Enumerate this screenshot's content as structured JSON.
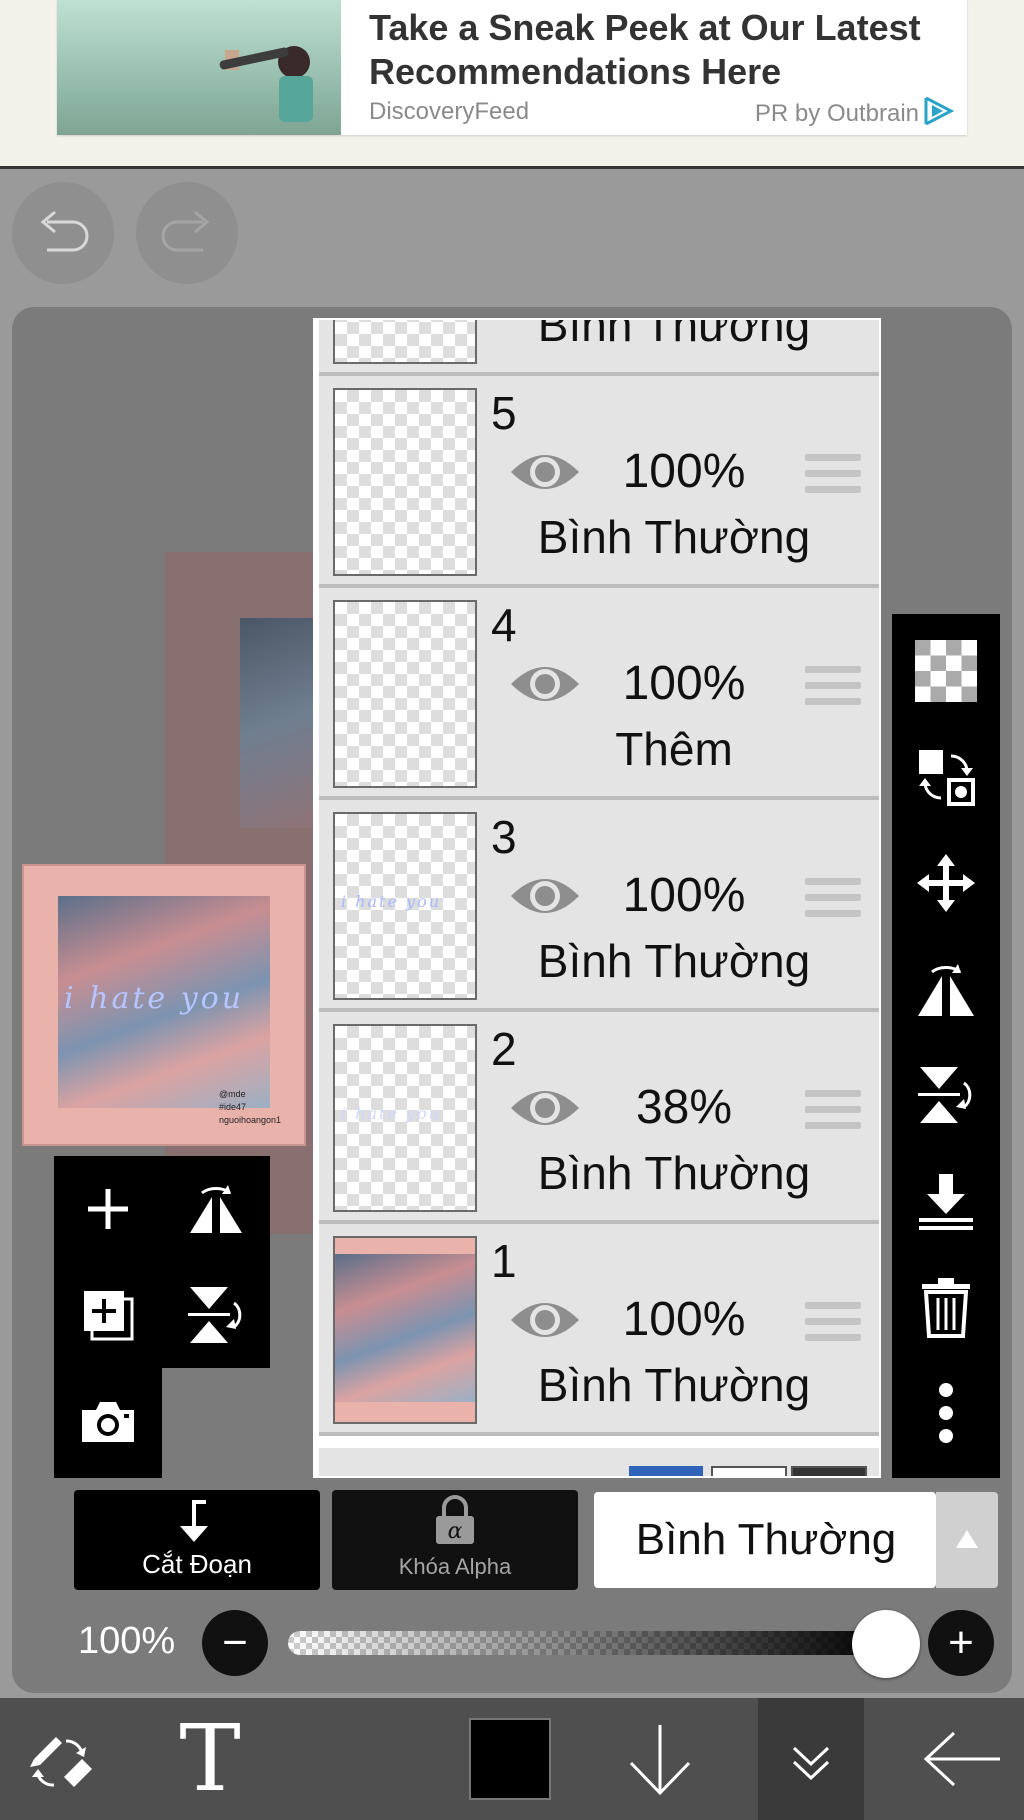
{
  "ad": {
    "title": "Take a Sneak Peek at Our Latest Recommendations Here",
    "source": "DiscoveryFeed",
    "pr_label": "PR by Outbrain"
  },
  "toolbar_top": {
    "undo_icon": "undo-icon",
    "redo_icon": "redo-icon"
  },
  "preview": {
    "overlay_text": "i  hate  you",
    "caption_lines": [
      "@mde",
      "#ide47",
      "nguoihoangon1"
    ]
  },
  "layers": {
    "top_partial_blend": "Bình Thường",
    "items": [
      {
        "number": "5",
        "opacity": "100%",
        "blend": "Bình Thường",
        "visible": true
      },
      {
        "number": "4",
        "opacity": "100%",
        "blend": "Thêm",
        "visible": true
      },
      {
        "number": "3",
        "opacity": "100%",
        "blend": "Bình Thường",
        "visible": true
      },
      {
        "number": "2",
        "opacity": "38%",
        "blend": "Bình Thường",
        "visible": true
      },
      {
        "number": "1",
        "opacity": "100%",
        "blend": "Bình Thường",
        "visible": true
      }
    ]
  },
  "left_tools": [
    "add-layer-icon",
    "flip-horizontal-icon",
    "duplicate-layer-icon",
    "flip-vertical-icon",
    "camera-icon"
  ],
  "right_tools": [
    "transparency-icon",
    "swap-layer-icon",
    "move-icon",
    "flip-horizontal-icon",
    "flip-vertical-icon",
    "merge-down-icon",
    "trash-icon",
    "more-icon"
  ],
  "controls": {
    "clip_label": "Cắt Đoạn",
    "alpha_lock_label": "Khóa Alpha",
    "blend_mode": "Bình Thường",
    "opacity_label": "100%",
    "opacity_value": 1.0,
    "minus": "−",
    "plus": "+"
  },
  "bottom_bar": {
    "text_tool": "T",
    "color": "#000000",
    "icons": [
      "brush-eraser-swap-icon",
      "text-tool-icon",
      "color-swatch",
      "arrow-down-icon",
      "collapse-icon",
      "back-arrow-icon"
    ]
  }
}
